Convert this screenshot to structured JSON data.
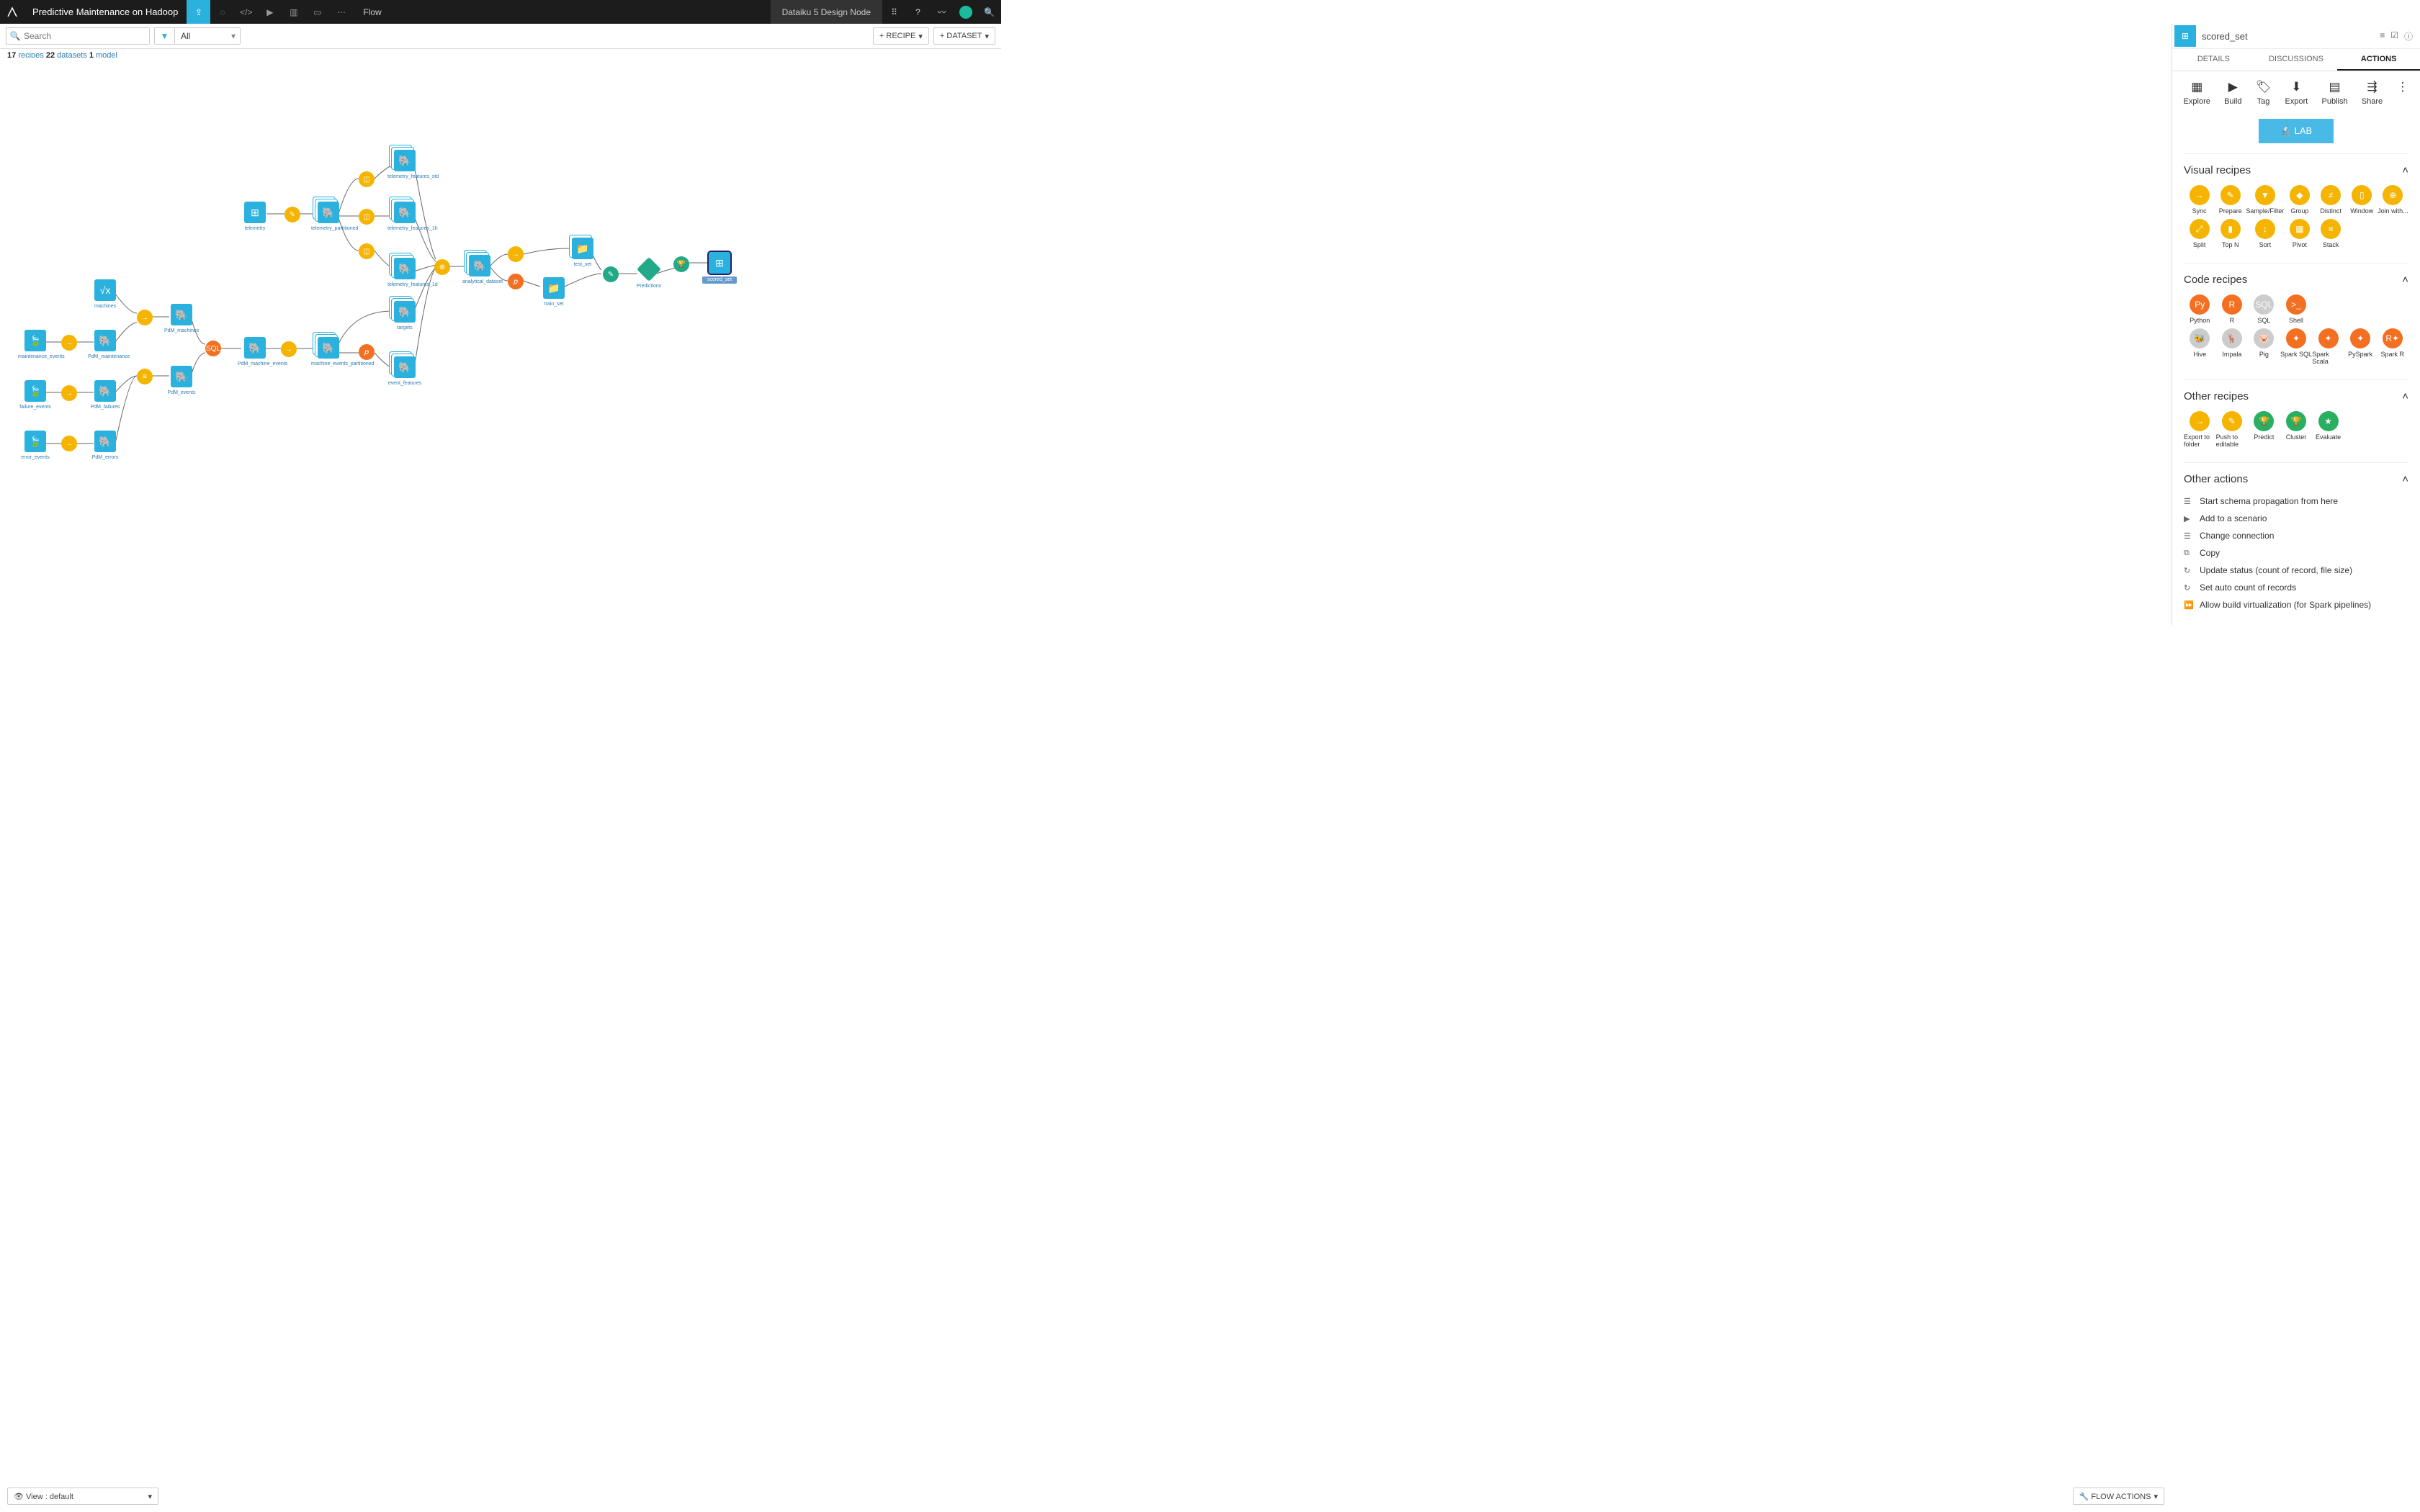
{
  "header": {
    "project_title": "Predictive Maintenance on Hadoop",
    "flow_label": "Flow",
    "env": "Dataiku 5 Design Node"
  },
  "toolbar": {
    "search_placeholder": "Search",
    "filter_value": "All",
    "add_recipe": "+ RECIPE",
    "add_dataset": "+ DATASET"
  },
  "counts": {
    "recipes_n": "17",
    "recipes_l": "recipes",
    "datasets_n": "22",
    "datasets_l": "datasets",
    "models_n": "1",
    "models_l": "model"
  },
  "bottom": {
    "view_label": "View : default",
    "flow_actions": "FLOW ACTIONS"
  },
  "panel": {
    "name": "scored_set",
    "tabs": {
      "details": "DETAILS",
      "discussions": "DISCUSSIONS",
      "actions": "ACTIONS"
    },
    "actions_row": [
      "Explore",
      "Build",
      "Tag",
      "Export",
      "Publish",
      "Share"
    ],
    "lab": "LAB",
    "sections": {
      "visual": {
        "title": "Visual recipes",
        "items": [
          "Sync",
          "Prepare",
          "Sample/Filter",
          "Group",
          "Distinct",
          "Window",
          "Join with...",
          "Split",
          "Top N",
          "Sort",
          "Pivot",
          "Stack"
        ]
      },
      "code": {
        "title": "Code recipes",
        "items": [
          "Python",
          "R",
          "SQL",
          "Shell",
          "Hive",
          "Impala",
          "Pig",
          "Spark SQL",
          "Spark Scala",
          "PySpark",
          "Spark R"
        ]
      },
      "other": {
        "title": "Other recipes",
        "items": [
          "Export to folder",
          "Push to editable",
          "Predict",
          "Cluster",
          "Evaluate"
        ]
      },
      "other_actions": {
        "title": "Other actions",
        "items": [
          "Start schema propagation from here",
          "Add to a scenario",
          "Change connection",
          "Copy",
          "Update status (count of record, file size)",
          "Set auto count of records",
          "Allow build virtualization (for Spark pipelines)"
        ]
      }
    }
  },
  "nodes": {
    "telemetry": "telemetry",
    "machines": "machines",
    "maintenance_events": "maintenance_events",
    "failure_events": "failure_events",
    "error_events": "error_events",
    "pdm_machines": "PdM_machines",
    "pdm_maintenance": "PdM_maintenance",
    "pdm_failures": "PdM_failures",
    "pdm_errors": "PdM_errors",
    "pdm_events": "PdM_events",
    "telemetry_partitioned": "telemetry_partitioned",
    "pdm_machine_events": "PdM_machine_events",
    "machine_events_partitioned": "machine_events_partitioned",
    "telemetry_features_std": "telemetry_features_std",
    "telemetry_features_1h": "telemetry_features_1h",
    "telemetry_features_1d": "telemetry_features_1d",
    "targets": "targets",
    "event_features": "event_features",
    "analytical_dataset": "analytical_dataset",
    "test_set": "test_set",
    "train_set": "train_set",
    "predictions": "Predictions",
    "scored_set": "scored_set"
  }
}
